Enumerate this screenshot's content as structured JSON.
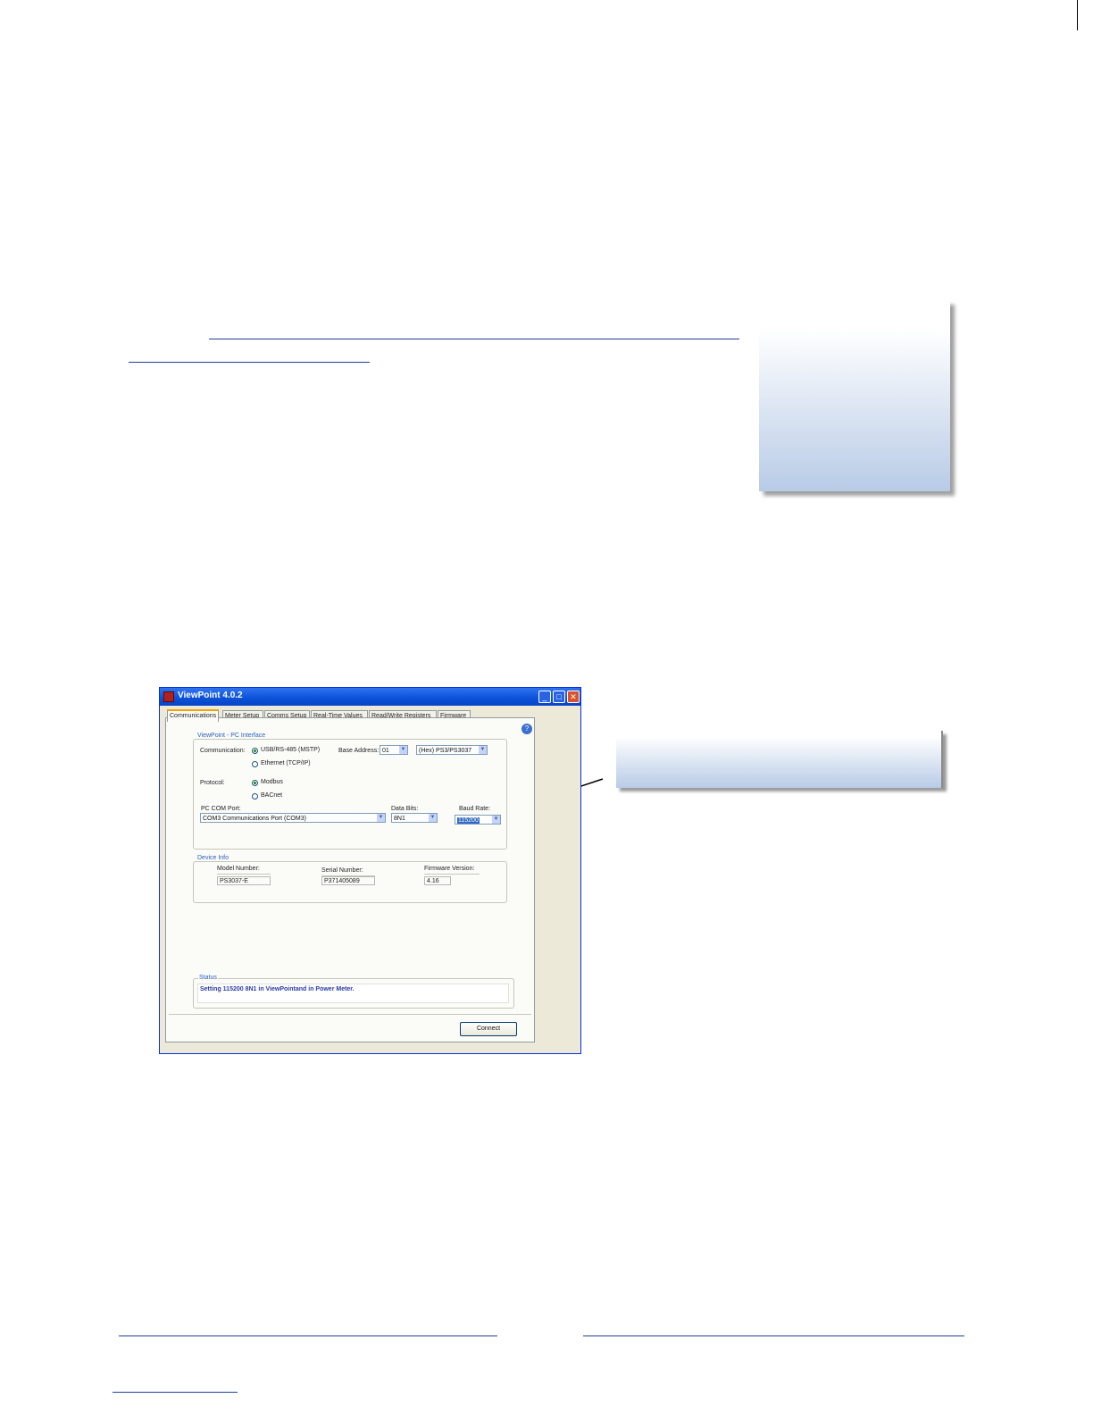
{
  "window": {
    "title": "ViewPoint 4.0.2",
    "controls": {
      "minimize": "_",
      "maximize": "□",
      "close": "✕"
    }
  },
  "tabs": [
    {
      "label": "Communications",
      "active": true
    },
    {
      "label": "Meter Setup"
    },
    {
      "label": "Comms Setup"
    },
    {
      "label": "Real-Time Values"
    },
    {
      "label": "Read/Write Registers"
    },
    {
      "label": "Firmware"
    }
  ],
  "help": {
    "glyph": "?"
  },
  "pc_interface": {
    "legend": "ViewPoint - PC Interface",
    "communication_label": "Communication:",
    "comm_options": [
      "USB/RS-485 (MSTP)",
      "Ethernet (TCP/IP)"
    ],
    "comm_selected": 0,
    "base_address_label": "Base Address:",
    "base_address_value": "01",
    "model_select_value": "(Hex) PS3/PS3037",
    "protocol_label": "Protocol:",
    "protocol_options": [
      "Modbus",
      "BACnet"
    ],
    "protocol_selected": 0,
    "com_port_label": "PC COM Port:",
    "com_port_value": "COM3 Communications Port (COM3)",
    "data_bits_label": "Data Bits:",
    "data_bits_value": "8N1",
    "baud_rate_label": "Baud Rate:",
    "baud_rate_value": "115200"
  },
  "device_info": {
    "legend": "Device Info",
    "model_label": "Model Number:",
    "model_value": "PS3037-E",
    "serial_label": "Serial Number:",
    "serial_value": "P371405089",
    "firmware_label": "Firmware Version:",
    "firmware_value": "4.16"
  },
  "status": {
    "legend": "Status",
    "message": "Setting 115200 8N1 in ViewPointand in Power Meter."
  },
  "connect_label": "Connect",
  "colors": {
    "title_bar": "#0a51d8",
    "link_underline": "#1f3f9a",
    "status_text": "#2b3ba8",
    "callout_gradient": "#b8cbe6"
  }
}
